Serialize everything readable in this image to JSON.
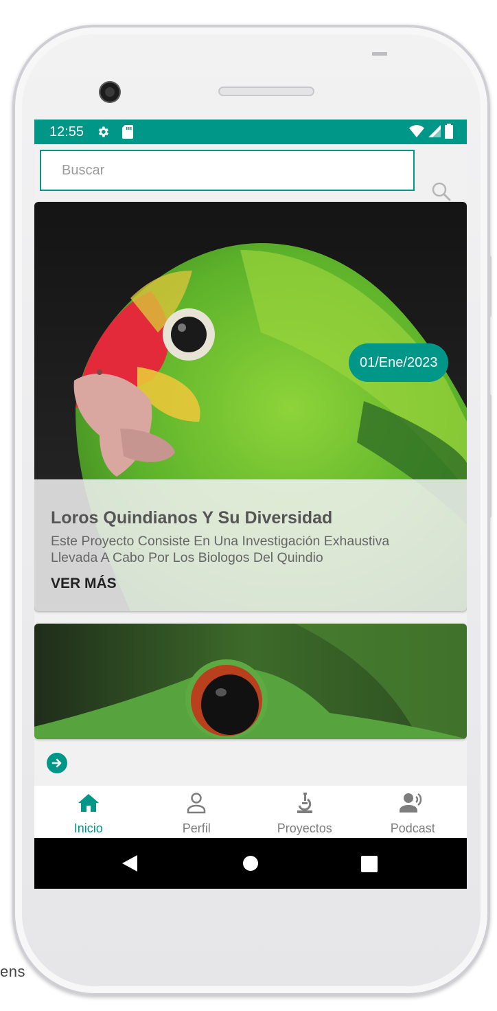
{
  "colors": {
    "accent": "#009688",
    "navbar": "#000000",
    "background": "#f1f1f1"
  },
  "statusbar": {
    "time": "12:55"
  },
  "search": {
    "placeholder": "Buscar"
  },
  "cards": [
    {
      "date": "01/Ene/2023",
      "title": "Loros Quindianos Y Su Diversidad",
      "description": "Este Proyecto Consiste En Una Investigación Exhaustiva Llevada A Cabo Por Los Biologos Del Quindio",
      "more_label": "VER MÁS",
      "image": "parrot-photo"
    },
    {
      "image": "frog-photo"
    }
  ],
  "bottom_nav": [
    {
      "label": "Inicio",
      "icon": "home-icon",
      "active": true
    },
    {
      "label": "Perfil",
      "icon": "person-icon",
      "active": false
    },
    {
      "label": "Proyectos",
      "icon": "microscope-icon",
      "active": false
    },
    {
      "label": "Podcast",
      "icon": "speaker-person-icon",
      "active": false
    }
  ],
  "frame": {
    "edge_text": "ens"
  }
}
